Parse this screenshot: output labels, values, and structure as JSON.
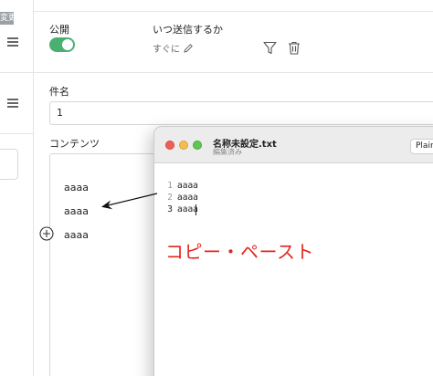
{
  "left_rail": {
    "badge_text": "変更"
  },
  "form": {
    "public": {
      "label": "公開",
      "enabled": true
    },
    "timing": {
      "label": "いつ送信するか",
      "value": "すぐに"
    },
    "subject": {
      "label": "件名",
      "value": "1"
    },
    "content": {
      "label": "コンテンツ",
      "lines": [
        "aaaa",
        "aaaa",
        "aaaa"
      ]
    }
  },
  "editor": {
    "title": "名称未設定.txt",
    "status": "編集済み",
    "format": "Plain",
    "lines": [
      {
        "number": "1",
        "text": "aaaa"
      },
      {
        "number": "2",
        "text": "aaaa"
      },
      {
        "number": "3",
        "text": "aaaa"
      }
    ],
    "annotation": "コピー・ペースト"
  },
  "colors": {
    "toggle_on": "#4caf72",
    "annotation": "#e3261f",
    "close": "#ee5f57",
    "minimize": "#f5bd4f",
    "maximize": "#61c554"
  },
  "icons": {
    "menu": "hamburger-icon",
    "edit": "pencil-icon",
    "filter": "filter-icon",
    "delete": "trash-icon",
    "add": "plus-circle-icon"
  }
}
